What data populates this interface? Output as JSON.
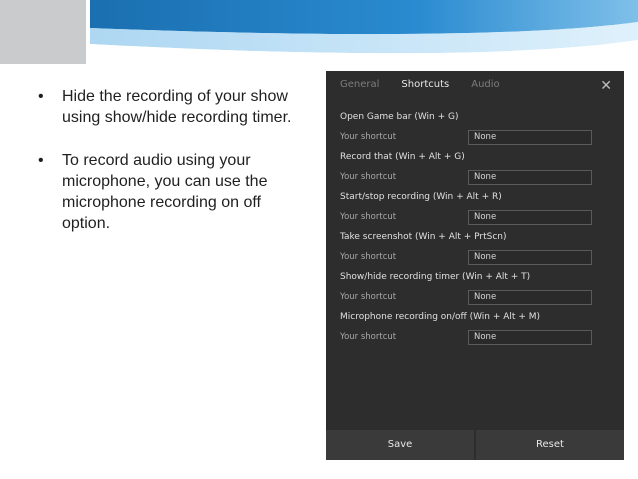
{
  "slide": {
    "bullets": [
      "Hide the recording of your show using show/hide recording timer.",
      "To record audio using your microphone, you can use the microphone recording on off option."
    ]
  },
  "panel": {
    "tabs": [
      "General",
      "Shortcuts",
      "Audio"
    ],
    "active_tab": "Shortcuts",
    "close_glyph": "✕",
    "shortcut_label": "Your shortcut",
    "actions": [
      {
        "title": "Open Game bar (Win + G)",
        "value": "None"
      },
      {
        "title": "Record that (Win + Alt + G)",
        "value": "None"
      },
      {
        "title": "Start/stop recording (Win + Alt + R)",
        "value": "None"
      },
      {
        "title": "Take screenshot (Win + Alt + PrtScn)",
        "value": "None"
      },
      {
        "title": "Show/hide recording timer (Win + Alt + T)",
        "value": "None"
      },
      {
        "title": "Microphone recording on/off (Win + Alt + M)",
        "value": "None"
      }
    ],
    "save_label": "Save",
    "reset_label": "Reset"
  },
  "colors": {
    "banner_blue": "#1e7fc4",
    "banner_light": "#6fb3e3",
    "panel_bg": "#2d2d2d",
    "footer_bg": "#3a3a3a"
  }
}
